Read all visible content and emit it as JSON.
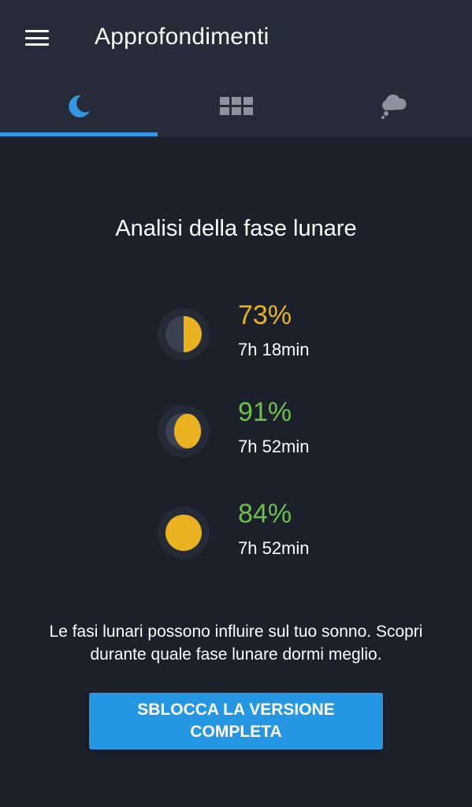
{
  "appbar": {
    "title": "Approfondimenti",
    "menu_icon": "hamburger-menu-icon"
  },
  "tabs": [
    {
      "name": "moon",
      "icon": "crescent-moon-icon",
      "active": true
    },
    {
      "name": "grid",
      "icon": "grid-icon",
      "active": false
    },
    {
      "name": "weather",
      "icon": "cloud-icon",
      "active": false
    }
  ],
  "colors": {
    "accent": "#3597e3",
    "moon_yellow": "#eab221",
    "green": "#6cc04a",
    "background": "#1b202b",
    "appbar": "#252b38"
  },
  "main": {
    "heading": "Analisi della fase lunare",
    "phases": [
      {
        "phase": "first-quarter",
        "percent": "73%",
        "duration": "7h 18min",
        "percent_color": "#eab221"
      },
      {
        "phase": "waxing-gibbous",
        "percent": "91%",
        "duration": "7h 52min",
        "percent_color": "#6cc04a"
      },
      {
        "phase": "full-moon",
        "percent": "84%",
        "duration": "7h 52min",
        "percent_color": "#6cc04a"
      }
    ],
    "description": "Le fasi lunari possono influire sul tuo sonno. Scopri durante quale fase lunare dormi meglio.",
    "unlock_button": "SBLOCCA LA VERSIONE COMPLETA"
  }
}
